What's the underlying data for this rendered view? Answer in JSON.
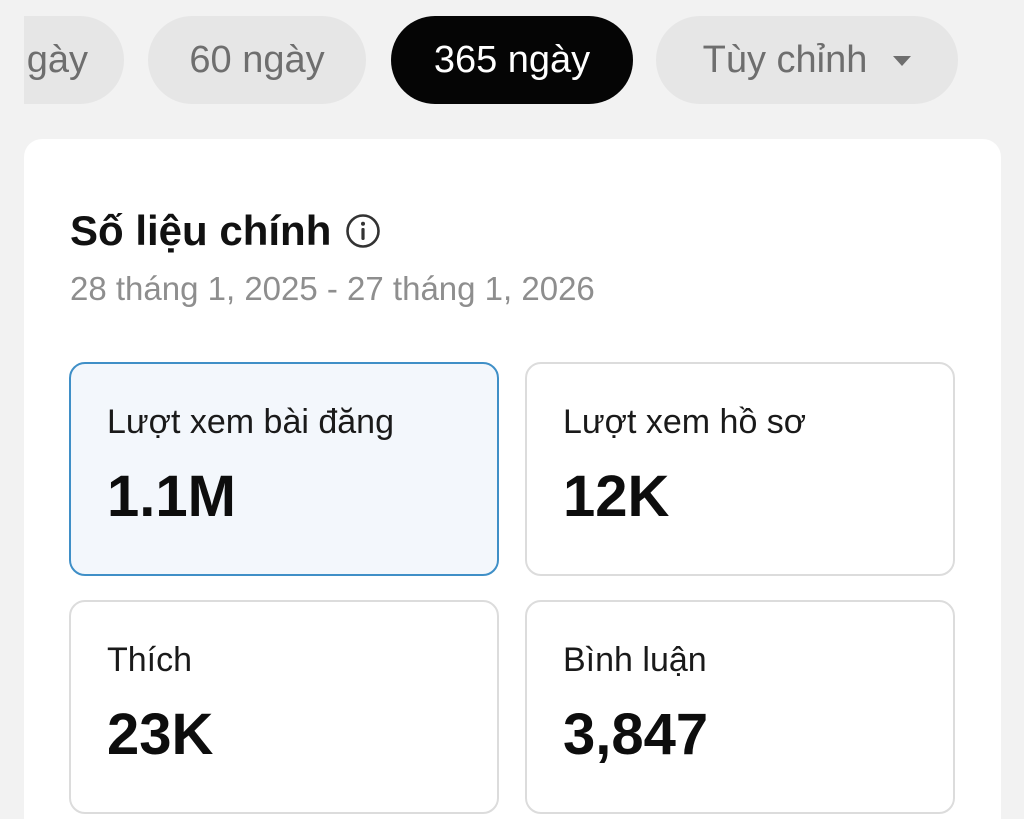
{
  "filters": {
    "partial_label": "gày",
    "chip_60": "60 ngày",
    "chip_365": "365 ngày",
    "chip_custom": "Tùy chỉnh",
    "selected": "365 ngày",
    "custom_icon": "caret-down-icon"
  },
  "card": {
    "title": "Số liệu chính",
    "title_icon": "info-icon",
    "date_range": "28 tháng 1, 2025 - 27 tháng 1, 2026",
    "metrics": [
      {
        "label": "Lượt xem bài đăng",
        "value": "1.1M",
        "selected": true
      },
      {
        "label": "Lượt xem hồ sơ",
        "value": "12K",
        "selected": false
      },
      {
        "label": "Thích",
        "value": "23K",
        "selected": false
      },
      {
        "label": "Bình luận",
        "value": "3,847",
        "selected": false
      }
    ]
  },
  "colors": {
    "background": "#f2f2f2",
    "chip": "#e6e6e6",
    "chip_selected": "#050505",
    "selected_border": "#3f8fc7",
    "selected_fill": "#f3f7fc",
    "muted_text": "#8e8e8e"
  }
}
